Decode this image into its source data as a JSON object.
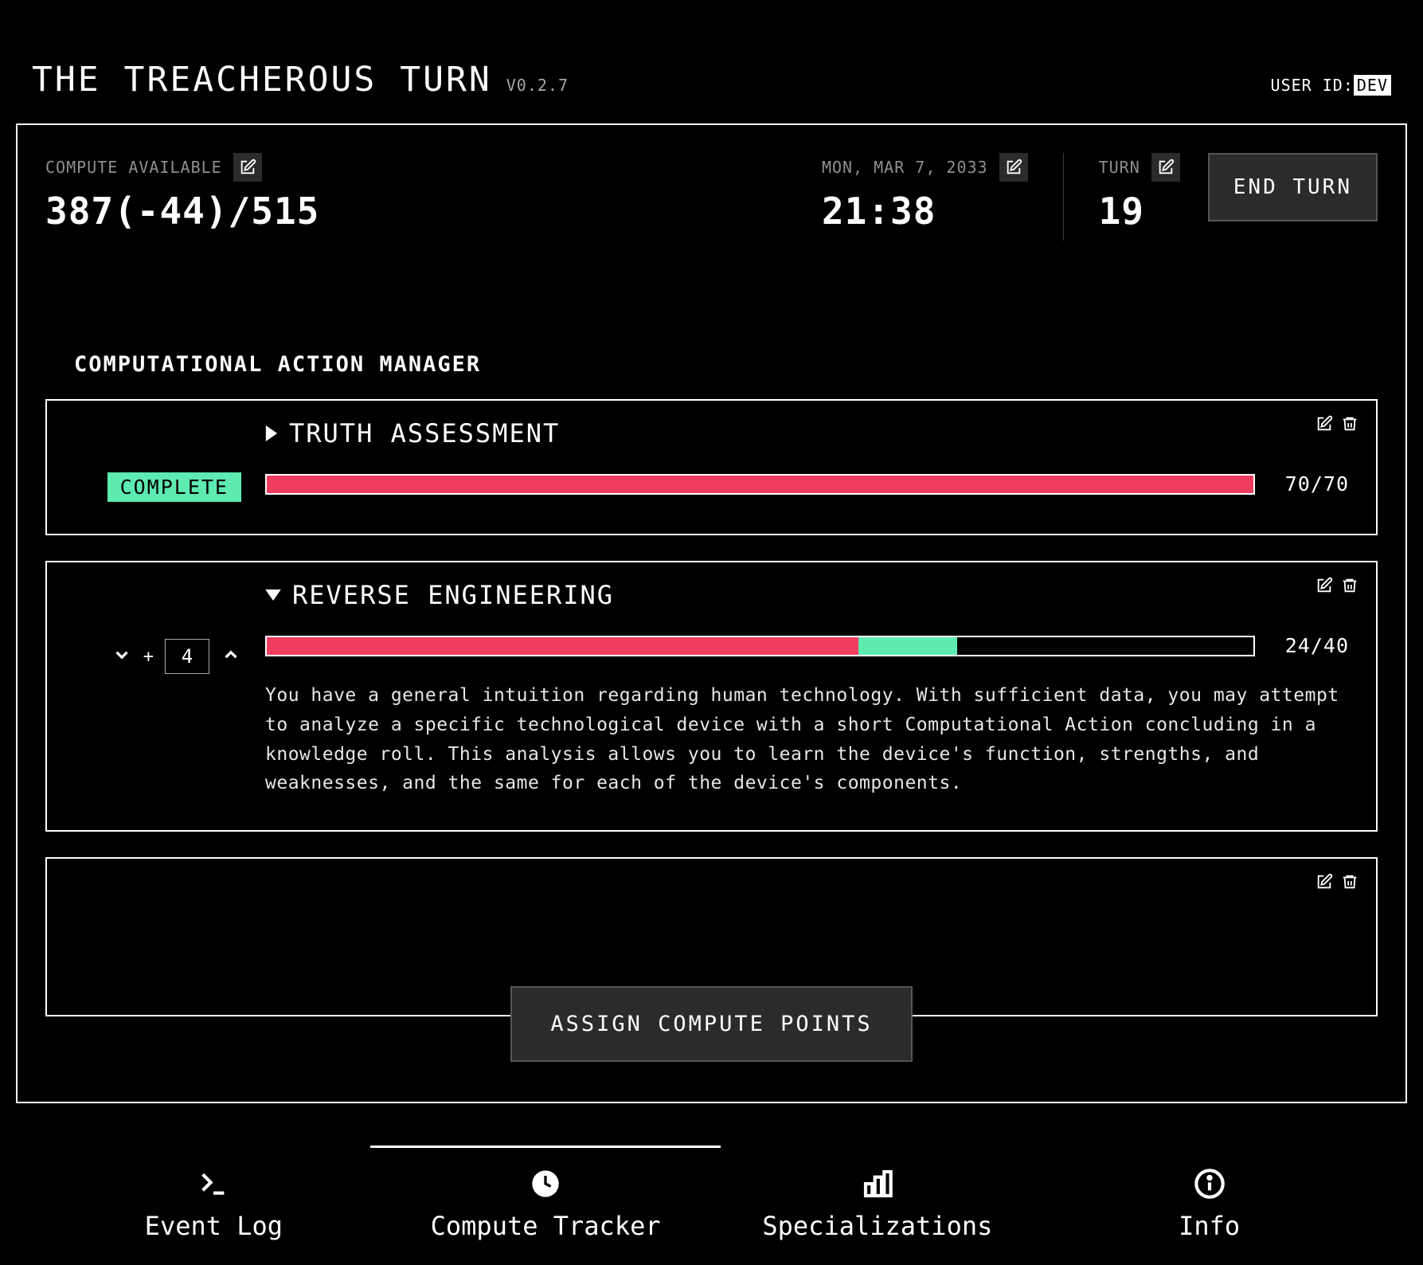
{
  "header": {
    "title": "THE TREACHEROUS TURN",
    "version": "V0.2.7",
    "user_id_label": "USER ID:",
    "user_id_value": "DEV"
  },
  "stats": {
    "compute_label": "COMPUTE AVAILABLE",
    "compute_value": "387(-44)/515",
    "date_label": "MON, MAR 7, 2033",
    "time_value": "21:38",
    "turn_label": "TURN",
    "turn_value": "19",
    "end_turn_label": "END TURN"
  },
  "section_title": "COMPUTATIONAL ACTION MANAGER",
  "actions": [
    {
      "title": "TRUTH ASSESSMENT",
      "expanded": false,
      "status": "COMPLETE",
      "progress_current": 70,
      "progress_pending": 0,
      "progress_total": 70,
      "progress_text": "70/70"
    },
    {
      "title": "REVERSE ENGINEERING",
      "expanded": true,
      "stepper_value": "4",
      "progress_current": 24,
      "progress_pending": 4,
      "progress_total": 40,
      "progress_text": "24/40",
      "description": "You have a general intuition regarding human technology. With sufficient data, you may attempt to analyze a specific technological device with a short Computational Action concluding in a knowledge roll. This analysis allows you to learn the device's function, strengths, and weaknesses, and the same for each of the device's components."
    }
  ],
  "assign_button": "ASSIGN COMPUTE POINTS",
  "nav": {
    "event_log": "Event Log",
    "compute_tracker": "Compute Tracker",
    "specializations": "Specializations",
    "info": "Info",
    "active": "compute_tracker"
  },
  "colors": {
    "accent_green": "#5eebb0",
    "accent_red": "#ef3c5f",
    "panel_border": "#ffffff"
  }
}
